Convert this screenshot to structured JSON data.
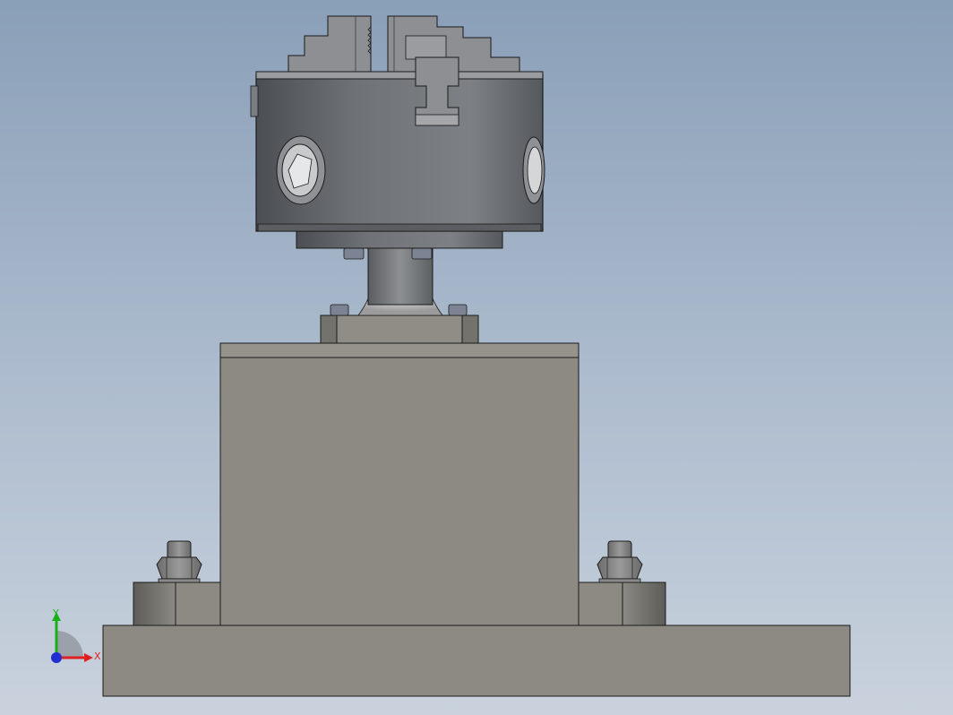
{
  "viewport": {
    "background_top": "#8a9fb8",
    "background_bottom": "#c9d2dd"
  },
  "model": {
    "part_color": "#8c8a83",
    "chuck_color": "#707478",
    "edge_color": "#1a1a1a"
  },
  "triad": {
    "x_label": "X",
    "y_label": "Y",
    "x_color": "#e02020",
    "y_color": "#18b018",
    "z_color": "#2030d0"
  }
}
